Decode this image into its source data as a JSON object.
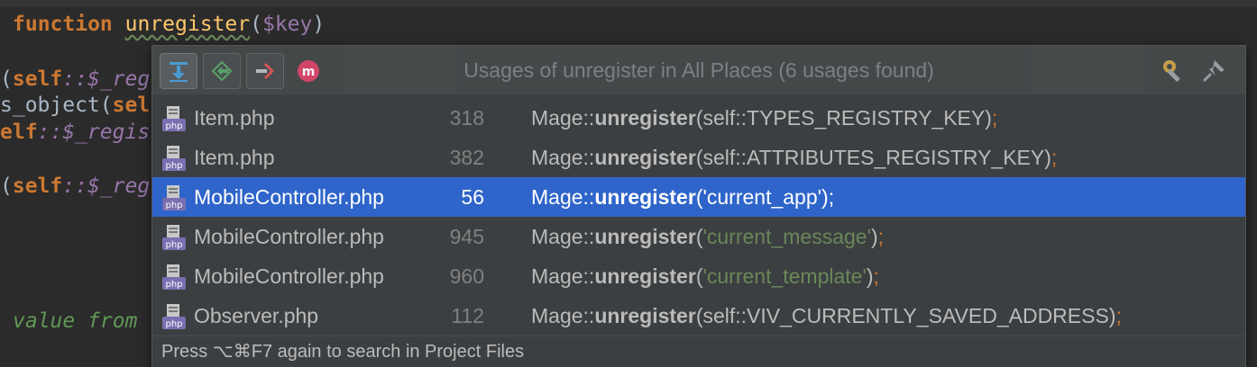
{
  "editor": {
    "line1": {
      "keyword": "function",
      "name": "unregister",
      "paren_open": "(",
      "param": "$key",
      "paren_close": ")"
    },
    "frag1": {
      "text": "(",
      "self": "self",
      "rest": "::$_reg"
    },
    "frag2": {
      "text": "s_object(",
      "self": "sel"
    },
    "frag3": {
      "self": "elf",
      "rest": "::$_regis"
    },
    "frag4": {
      "text": "(",
      "self": "self",
      "rest": "::$_reg"
    },
    "frag5": {
      "comment": "value from"
    }
  },
  "popup": {
    "title": "Usages of unregister in All Places (6 usages found)",
    "toolbar": [
      {
        "name": "merge-usages-button",
        "icon": "download-arrow-icon"
      },
      {
        "name": "previous-occurrence-button",
        "icon": "diff-arrows-icon"
      },
      {
        "name": "next-occurrence-button",
        "icon": "next-arrow-icon"
      },
      {
        "name": "method-filter-button",
        "icon": "method-m-icon"
      }
    ],
    "rows": [
      {
        "file": "Item.php",
        "line": "318",
        "prefix": "Mage::",
        "method": "unregister",
        "args": "(self::TYPES_REGISTRY_KEY)",
        "str": "",
        "close": "",
        "semi": ";",
        "selected": false
      },
      {
        "file": "Item.php",
        "line": "382",
        "prefix": "Mage::",
        "method": "unregister",
        "args": "(self::ATTRIBUTES_REGISTRY_KEY)",
        "str": "",
        "close": "",
        "semi": ";",
        "selected": false
      },
      {
        "file": "MobileController.php",
        "line": "56",
        "prefix": "Mage::",
        "method": "unregister",
        "args": "(",
        "str": "'current_app'",
        "close": ")",
        "semi": ";",
        "selected": true
      },
      {
        "file": "MobileController.php",
        "line": "945",
        "prefix": "Mage::",
        "method": "unregister",
        "args": "(",
        "str": "'current_message'",
        "close": ")",
        "semi": ";",
        "selected": false
      },
      {
        "file": "MobileController.php",
        "line": "960",
        "prefix": "Mage::",
        "method": "unregister",
        "args": "(",
        "str": "'current_template'",
        "close": ")",
        "semi": ";",
        "selected": false
      },
      {
        "file": "Observer.php",
        "line": "112",
        "prefix": "Mage::",
        "method": "unregister",
        "args": "(self::VIV_CURRENTLY_SAVED_ADDRESS)",
        "str": "",
        "close": "",
        "semi": ";",
        "selected": false
      }
    ],
    "footer": "Press ⌥⌘F7 again to search in Project Files",
    "colors": {
      "selection": "#2f65ca",
      "string": "#6a8759",
      "keyword": "#cc7832"
    }
  }
}
